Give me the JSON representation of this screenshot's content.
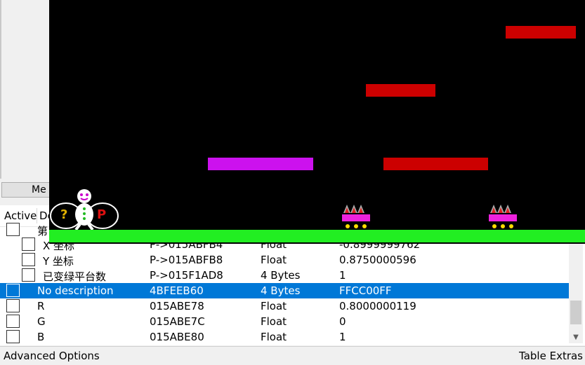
{
  "background_app": {
    "memory_button_label": "Me"
  },
  "game": {
    "player_letters": {
      "left": "?",
      "right": "P"
    },
    "colors": {
      "background": "#000000",
      "ground": "#22ee22",
      "platform_red": "#cc0000",
      "platform_purple": "#cc11ee",
      "spike_base": "#ee22dd"
    }
  },
  "cheat_table": {
    "headers": {
      "active": "Active",
      "description": "De"
    },
    "rows": [
      {
        "desc": "第",
        "addr": "",
        "type": "",
        "value": "",
        "indent": 1,
        "selected": false
      },
      {
        "desc": "X 坐标",
        "addr": "P->015ABFB4",
        "type": "Float",
        "value": "-0.8999999762",
        "indent": 2,
        "selected": false
      },
      {
        "desc": "Y 坐标",
        "addr": "P->015ABFB8",
        "type": "Float",
        "value": "0.8750000596",
        "indent": 2,
        "selected": false
      },
      {
        "desc": "已变绿平台数",
        "addr": "P->015F1AD8",
        "type": "4 Bytes",
        "value": "1",
        "indent": 2,
        "selected": false
      },
      {
        "desc": "No description",
        "addr": "4BFEEB60",
        "type": "4 Bytes",
        "value": "FFCC00FF",
        "indent": 1,
        "selected": true
      },
      {
        "desc": "R",
        "addr": "015ABE78",
        "type": "Float",
        "value": "0.8000000119",
        "indent": 1,
        "selected": false
      },
      {
        "desc": "G",
        "addr": "015ABE7C",
        "type": "Float",
        "value": "0",
        "indent": 1,
        "selected": false
      },
      {
        "desc": "B",
        "addr": "015ABE80",
        "type": "Float",
        "value": "1",
        "indent": 1,
        "selected": false
      }
    ]
  },
  "footer": {
    "advanced_options": "Advanced Options",
    "table_extras": "Table Extras"
  }
}
